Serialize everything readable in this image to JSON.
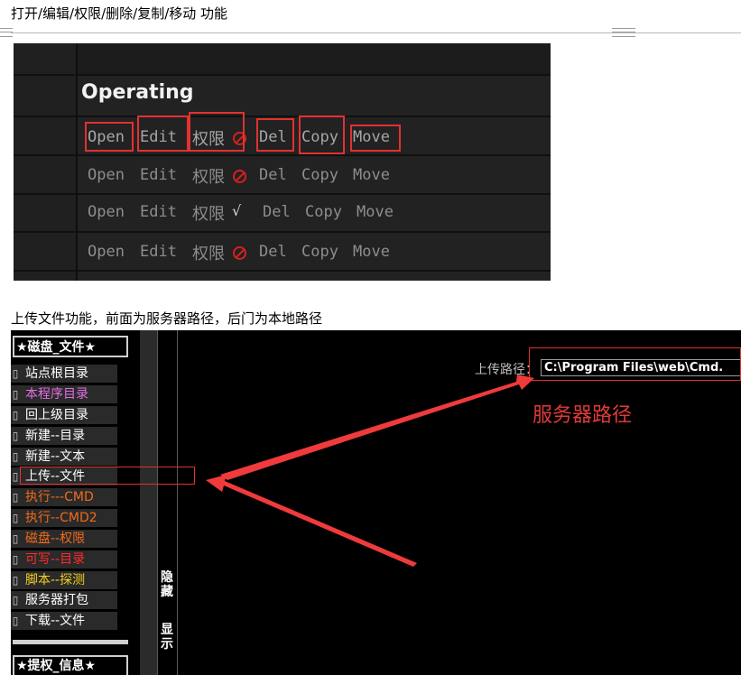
{
  "doc": {
    "caption1": "打开/编辑/权限/删除/复制/移动 功能",
    "caption2": "上传文件功能，前面为服务器路径，后门为本地路径"
  },
  "shot1": {
    "header": "Operating",
    "rows": [
      {
        "open": "Open",
        "edit": "Edit",
        "perm": "权限",
        "perm_icon": "forbid-icon",
        "del": "Del",
        "copy": "Copy",
        "move": "Move"
      },
      {
        "open": "Open",
        "edit": "Edit",
        "perm": "权限",
        "perm_icon": "forbid-icon",
        "del": "Del",
        "copy": "Copy",
        "move": "Move"
      },
      {
        "open": "Open",
        "edit": "Edit",
        "perm": "权限",
        "perm_icon": "check-icon",
        "del": "Del",
        "copy": "Copy",
        "move": "Move"
      },
      {
        "open": "Open",
        "edit": "Edit",
        "perm": "权限",
        "perm_icon": "forbid-icon",
        "del": "Del",
        "copy": "Copy",
        "move": "Move"
      }
    ],
    "check_glyph": "√",
    "colors": {
      "highlight": "#e23131",
      "text": "#8d8d8d",
      "bg": "#1c1c1c"
    }
  },
  "shot2": {
    "sidebar_title": "★磁盘_文件★",
    "sidebar_title2": "★提权_信息★",
    "items": [
      {
        "label": "站点根目录",
        "color": "#ffffff"
      },
      {
        "label": "本程序目录",
        "color": "#e36ee3"
      },
      {
        "label": "回上级目录",
        "color": "#ffffff"
      },
      {
        "label": "新建--目录",
        "color": "#ffffff"
      },
      {
        "label": "新建--文本",
        "color": "#ffffff"
      },
      {
        "label": "上传--文件",
        "color": "#ffffff"
      },
      {
        "label": "执行---CMD",
        "color": "#f06a1a"
      },
      {
        "label": "执行--CMD2",
        "color": "#f06a1a"
      },
      {
        "label": "磁盘--权限",
        "color": "#f06a1a"
      },
      {
        "label": "可写--目录",
        "color": "#ff2a2a"
      },
      {
        "label": "脚本--探测",
        "color": "#f0d020"
      },
      {
        "label": "服务器打包",
        "color": "#ffffff"
      },
      {
        "label": "下载--文件",
        "color": "#ffffff"
      }
    ],
    "item_icon": "▯",
    "hide_text": "隐\n藏",
    "show_text": "显\n示",
    "upload_label": "上传路径：",
    "upload_value": "C:\\Program Files\\web\\Cmd.",
    "server_path_label": "服务器路径",
    "colors": {
      "arrow": "#ef3b3b",
      "box": "#e23131"
    }
  }
}
